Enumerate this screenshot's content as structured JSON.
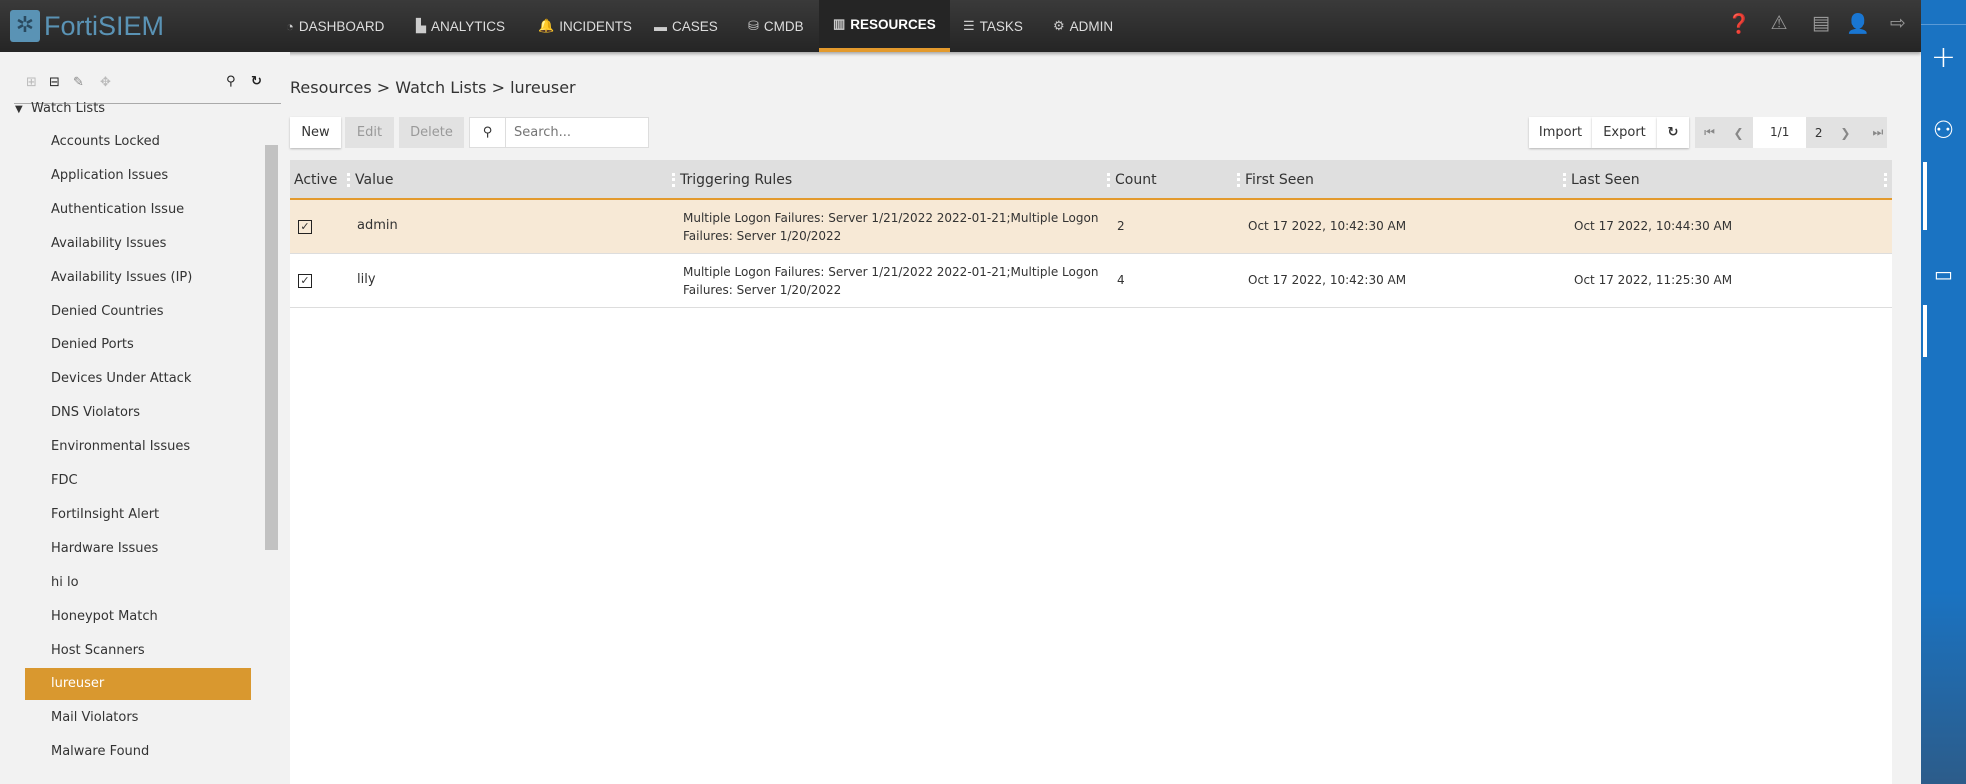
{
  "app": {
    "logo": "FortiSIEM"
  },
  "nav": [
    {
      "label": "DASHBOARD",
      "icon": "dashboard-icon"
    },
    {
      "label": "ANALYTICS",
      "icon": "chart-icon"
    },
    {
      "label": "INCIDENTS",
      "icon": "bell-icon"
    },
    {
      "label": "CASES",
      "icon": "archive-icon"
    },
    {
      "label": "CMDB",
      "icon": "database-icon"
    },
    {
      "label": "RESOURCES",
      "icon": "bar-chart-icon"
    },
    {
      "label": "TASKS",
      "icon": "tasks-icon"
    },
    {
      "label": "ADMIN",
      "icon": "gears-icon"
    }
  ],
  "sidebar": {
    "root": "Watch Lists",
    "items": [
      "Accounts Locked",
      "Application Issues",
      "Authentication Issue",
      "Availability Issues",
      "Availability Issues (IP)",
      "Denied Countries",
      "Denied Ports",
      "Devices Under Attack",
      "DNS Violators",
      "Environmental Issues",
      "FDC",
      "FortiInsight Alert",
      "Hardware Issues",
      "hi lo",
      "Honeypot Match",
      "Host Scanners",
      "lureuser",
      "Mail Violators",
      "Malware Found"
    ],
    "selected": "lureuser"
  },
  "breadcrumb": "Resources > Watch Lists > lureuser",
  "toolbar": {
    "new": "New",
    "edit": "Edit",
    "delete": "Delete",
    "search_placeholder": "Search...",
    "import": "Import",
    "export": "Export"
  },
  "pager": {
    "current": "1/1",
    "page_size": "2"
  },
  "table": {
    "columns": [
      "Active",
      "Value",
      "Triggering Rules",
      "Count",
      "First Seen",
      "Last Seen"
    ],
    "rows": [
      {
        "active": true,
        "value": "admin",
        "rules": "Multiple Logon Failures: Server 1/21/2022 2022-01-21;Multiple Logon Failures: Server 1/20/2022",
        "count": "2",
        "first": "Oct 17 2022, 10:42:30 AM",
        "last": "Oct 17 2022, 10:44:30 AM"
      },
      {
        "active": true,
        "value": "lily",
        "rules": "Multiple Logon Failures: Server 1/21/2022 2022-01-21;Multiple Logon Failures: Server 1/20/2022",
        "count": "4",
        "first": "Oct 17 2022, 10:42:30 AM",
        "last": "Oct 17 2022, 11:25:30 AM"
      }
    ]
  },
  "colors": {
    "accent": "#d9982f",
    "topbar": "#2b2b2b",
    "side_panel": "#1a73c2"
  }
}
